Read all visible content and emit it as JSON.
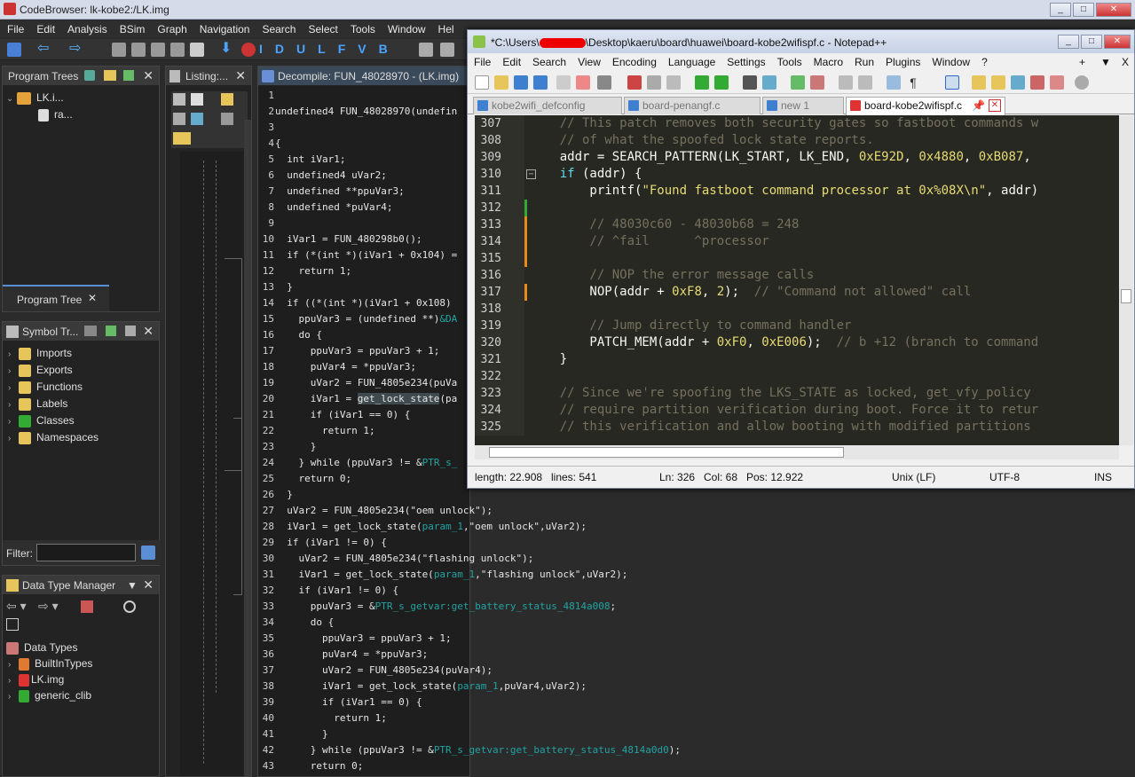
{
  "ghidra": {
    "title": "CodeBrowser: lk-kobe2:/LK.img",
    "menu": [
      "File",
      "Edit",
      "Analysis",
      "BSim",
      "Graph",
      "Navigation",
      "Search",
      "Select",
      "Tools",
      "Window",
      "Hel"
    ],
    "toolbar_letters": [
      "I",
      "D",
      "U",
      "L",
      "F",
      "V",
      "B"
    ],
    "program_trees": {
      "title": "Program Trees",
      "root": "LK.i...",
      "child": "ra...",
      "tab": "Program Tree"
    },
    "symbol_tree": {
      "title": "Symbol Tr...",
      "items": [
        "Imports",
        "Exports",
        "Functions",
        "Labels",
        "Classes",
        "Namespaces"
      ]
    },
    "filter_label": "Filter:",
    "data_type_manager": {
      "title": "Data Type Manager",
      "root": "Data Types",
      "items": [
        "BuiltInTypes",
        "LK.img",
        "generic_clib"
      ]
    },
    "listing": {
      "title": "Listing:..."
    },
    "decompile": {
      "title": "Decompile: FUN_48028970 -  (LK.img)",
      "lines": [
        {
          "n": "1",
          "t": ""
        },
        {
          "n": "2",
          "t": "undefined4 FUN_48028970(undefin"
        },
        {
          "n": "3",
          "t": ""
        },
        {
          "n": "4",
          "t": "{"
        },
        {
          "n": "5",
          "t": "  int iVar1;"
        },
        {
          "n": "6",
          "t": "  undefined4 uVar2;"
        },
        {
          "n": "7",
          "t": "  undefined **ppuVar3;"
        },
        {
          "n": "8",
          "t": "  undefined *puVar4;"
        },
        {
          "n": "9",
          "t": ""
        },
        {
          "n": "10",
          "t": "  iVar1 = FUN_480298b0();"
        },
        {
          "n": "11",
          "t": "  if (*(int *)(iVar1 + 0x104) ="
        },
        {
          "n": "12",
          "t": "    return 1;"
        },
        {
          "n": "13",
          "t": "  }"
        },
        {
          "n": "14",
          "t": "  if ((*(int *)(iVar1 + 0x108)"
        },
        {
          "n": "15",
          "t": "    ppuVar3 = (undefined **)&DA"
        },
        {
          "n": "16",
          "t": "    do {"
        },
        {
          "n": "17",
          "t": "      ppuVar3 = ppuVar3 + 1;"
        },
        {
          "n": "18",
          "t": "      puVar4 = *ppuVar3;"
        },
        {
          "n": "19",
          "t": "      uVar2 = FUN_4805e234(puVa"
        },
        {
          "n": "20",
          "t": "      iVar1 = get_lock_state(pa"
        },
        {
          "n": "21",
          "t": "      if (iVar1 == 0) {"
        },
        {
          "n": "22",
          "t": "        return 1;"
        },
        {
          "n": "23",
          "t": "      }"
        },
        {
          "n": "24",
          "t": "    } while (ppuVar3 != &PTR_s_"
        },
        {
          "n": "25",
          "t": "    return 0;"
        },
        {
          "n": "26",
          "t": "  }"
        },
        {
          "n": "27",
          "t": "  uVar2 = FUN_4805e234(\"oem unlock\");"
        },
        {
          "n": "28",
          "t": "  iVar1 = get_lock_state(param_1,\"oem unlock\",uVar2);"
        },
        {
          "n": "29",
          "t": "  if (iVar1 != 0) {"
        },
        {
          "n": "30",
          "t": "    uVar2 = FUN_4805e234(\"flashing unlock\");"
        },
        {
          "n": "31",
          "t": "    iVar1 = get_lock_state(param_1,\"flashing unlock\",uVar2);"
        },
        {
          "n": "32",
          "t": "    if (iVar1 != 0) {"
        },
        {
          "n": "33",
          "t": "      ppuVar3 = &PTR_s_getvar:get_battery_status_4814a008;"
        },
        {
          "n": "34",
          "t": "      do {"
        },
        {
          "n": "35",
          "t": "        ppuVar3 = ppuVar3 + 1;"
        },
        {
          "n": "36",
          "t": "        puVar4 = *ppuVar3;"
        },
        {
          "n": "37",
          "t": "        uVar2 = FUN_4805e234(puVar4);"
        },
        {
          "n": "38",
          "t": "        iVar1 = get_lock_state(param_1,puVar4,uVar2);"
        },
        {
          "n": "39",
          "t": "        if (iVar1 == 0) {"
        },
        {
          "n": "40",
          "t": "          return 1;"
        },
        {
          "n": "41",
          "t": "        }"
        },
        {
          "n": "42",
          "t": "      } while (ppuVar3 != &PTR_s_getvar:get_battery_status_4814a0d0);"
        },
        {
          "n": "43",
          "t": "      return 0;"
        }
      ]
    }
  },
  "npp": {
    "title": "*C:\\Users\\",
    "title_rest": "\\Desktop\\kaeru\\board\\huawei\\board-kobe2wifispf.c - Notepad++",
    "menu": [
      "File",
      "Edit",
      "Search",
      "View",
      "Encoding",
      "Language",
      "Settings",
      "Tools",
      "Macro",
      "Run",
      "Plugins",
      "Window",
      "?"
    ],
    "menu_right": [
      "+",
      "▼",
      "X"
    ],
    "tabs": [
      "kobe2wifi_defconfig",
      "board-penangf.c",
      "new 1",
      "board-kobe2wifispf.c"
    ],
    "lines": [
      {
        "n": "307",
        "html": "<span class='cm'>    // This patch removes both security gates so fastboot commands w</span>"
      },
      {
        "n": "308",
        "html": "<span class='cm'>    // of what the spoofed lock state reports.</span>"
      },
      {
        "n": "309",
        "html": "    addr = SEARCH_PATTERN(LK_START, LK_END, <span class='nm'>0xE92D</span>, <span class='nm'>0x4880</span>, <span class='nm'>0xB087</span>,"
      },
      {
        "n": "310",
        "html": "    <span class='kw'>if</span> (addr) {"
      },
      {
        "n": "311",
        "html": "        printf(<span class='st'>\"Found fastboot command processor at 0x%08X\\n\"</span>, addr)"
      },
      {
        "n": "312",
        "html": ""
      },
      {
        "n": "313",
        "html": "<span class='cm'>        // 48030c60 - 48030b68 = 248</span>"
      },
      {
        "n": "314",
        "html": "<span class='cm'>        // ^fail      ^processor</span>"
      },
      {
        "n": "315",
        "html": ""
      },
      {
        "n": "316",
        "html": "<span class='cm'>        // NOP the error message calls</span>"
      },
      {
        "n": "317",
        "html": "        NOP(addr + <span class='nm'>0xF8</span>, <span class='nm'>2</span>);  <span class='cm'>// \"Command not allowed\" call</span>"
      },
      {
        "n": "318",
        "html": ""
      },
      {
        "n": "319",
        "html": "<span class='cm'>        // Jump directly to command handler</span>"
      },
      {
        "n": "320",
        "html": "        PATCH_MEM(addr + <span class='nm'>0xF0</span>, <span class='nm'>0xE006</span>);  <span class='cm'>// b +12 (branch to command</span>"
      },
      {
        "n": "321",
        "html": "    }"
      },
      {
        "n": "322",
        "html": ""
      },
      {
        "n": "323",
        "html": "<span class='cm'>    // Since we're spoofing the LKS_STATE as locked, get_vfy_policy</span>"
      },
      {
        "n": "324",
        "html": "<span class='cm'>    // require partition verification during boot. Force it to retur</span>"
      },
      {
        "n": "325",
        "html": "<span class='cm'>    // this verification and allow booting with modified partitions</span>"
      }
    ],
    "status": {
      "length": "length: 22.908",
      "lines": "lines: 541",
      "ln": "Ln: 326",
      "col": "Col: 68",
      "pos": "Pos: 12.922",
      "eol": "Unix (LF)",
      "enc": "UTF-8",
      "ins": "INS"
    }
  }
}
